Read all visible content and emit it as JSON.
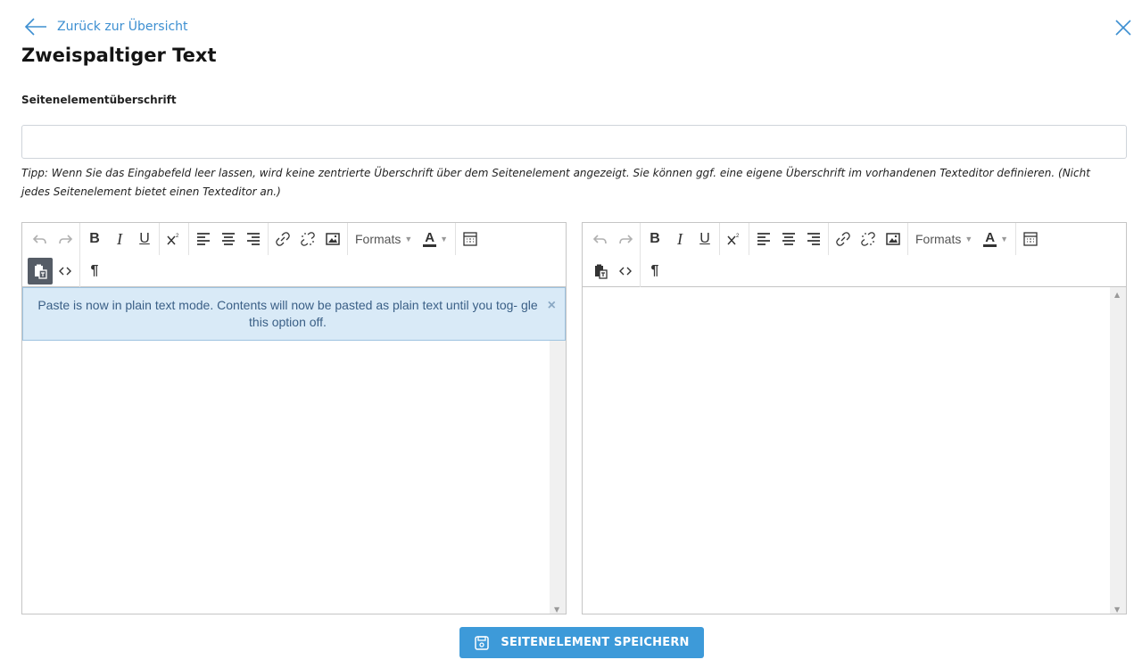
{
  "nav": {
    "back_label": "Zurück zur Übersicht"
  },
  "page": {
    "title": "Zweispaltiger Text"
  },
  "heading_field": {
    "label": "Seitenelementüberschrift",
    "value": "",
    "tip": "Tipp: Wenn Sie das Eingabefeld leer lassen, wird keine zentrierte Überschrift über dem Seitenelement angezeigt. Sie können ggf. eine eigene Überschrift im vorhandenen Texteditor definieren. (Nicht jedes Seitenelement bietet einen Texteditor an.)"
  },
  "toolbar": {
    "bold": "B",
    "italic": "I",
    "underline": "U",
    "formats_label": "Formats",
    "text_color_label": "A",
    "pilcrow": "¶"
  },
  "left_editor": {
    "notice": "Paste is now in plain text mode. Contents will now be pasted as plain text until you tog- gle this option off.",
    "notice_close": "×"
  },
  "save_button": {
    "label": "SEITENELEMENT SPEICHERN"
  },
  "colors": {
    "accent": "#3d9ad9",
    "link": "#3d8fd1",
    "notice_bg": "#d9eaf7"
  }
}
